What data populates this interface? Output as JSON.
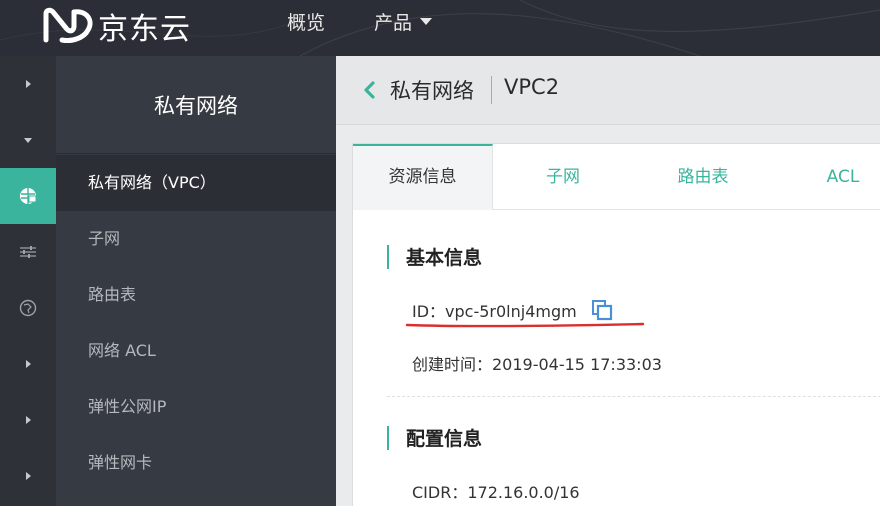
{
  "header": {
    "logo_text": "京东云",
    "nav": [
      {
        "label": "概览"
      },
      {
        "label": "产品"
      }
    ]
  },
  "sidebar": {
    "title": "私有网络",
    "items": [
      {
        "label": "私有网络（VPC）",
        "active": true
      },
      {
        "label": "子网"
      },
      {
        "label": "路由表"
      },
      {
        "label": "网络 ACL"
      },
      {
        "label": "弹性公网IP"
      },
      {
        "label": "弹性网卡"
      }
    ]
  },
  "breadcrumb": {
    "parent": "私有网络",
    "current": "VPC2"
  },
  "tabs": [
    {
      "label": "资源信息",
      "active": true
    },
    {
      "label": "子网"
    },
    {
      "label": "路由表"
    },
    {
      "label": "ACL"
    }
  ],
  "basic_info": {
    "title": "基本信息",
    "id_text": "ID：vpc-5r0lnj4mgm",
    "created_text": "创建时间：2019-04-15 17:33:03"
  },
  "config_info": {
    "title": "配置信息",
    "cidr_text": "CIDR：172.16.0.0/16"
  },
  "colors": {
    "accent": "#3bb49d",
    "topbar": "#2b2e36",
    "sidebar": "#363a42",
    "highlight_underline": "#d9302f"
  }
}
